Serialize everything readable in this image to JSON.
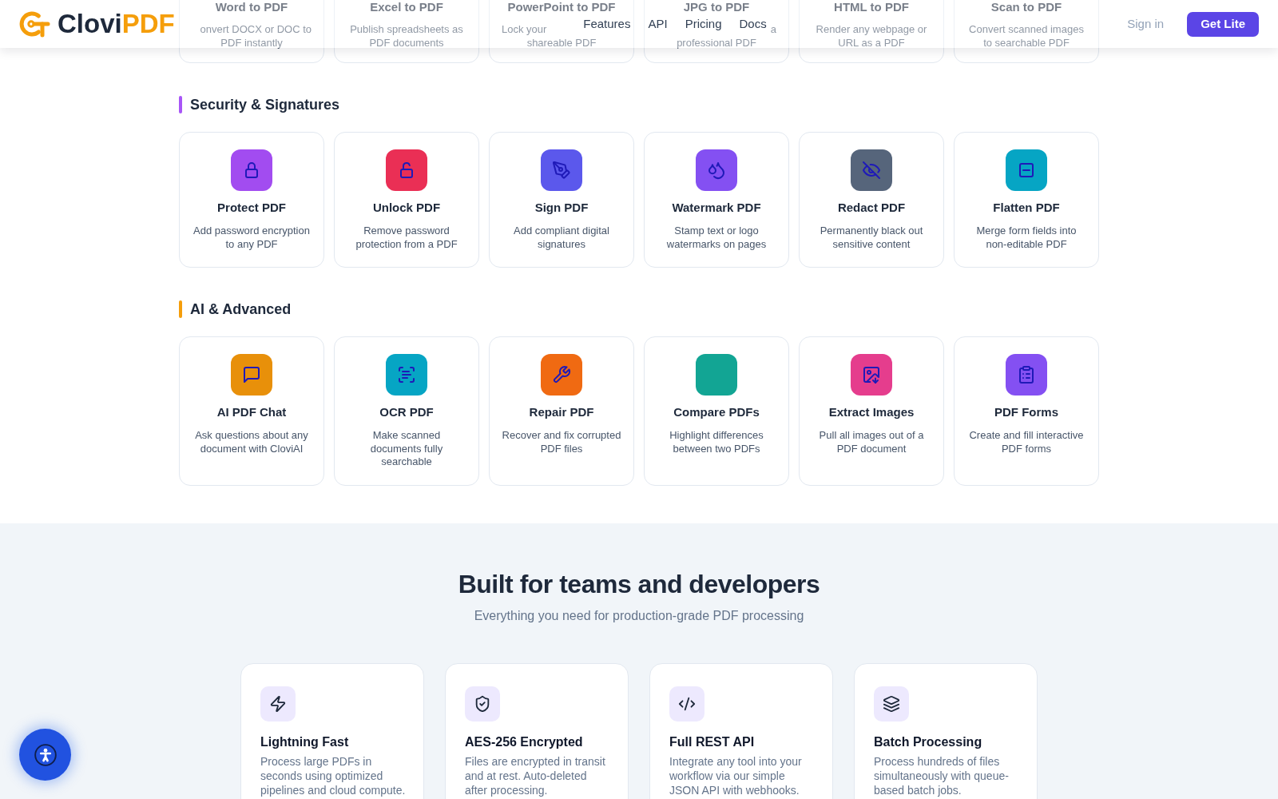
{
  "header": {
    "logo": {
      "name": "Clovi",
      "accent": "PDF"
    },
    "nav": [
      "Features",
      "API",
      "Pricing",
      "Docs"
    ],
    "sign_in": "Sign in",
    "cta": "Get Lite"
  },
  "tools_above": [
    {
      "title": "Word to PDF",
      "lines": [
        {
          "text": "onvert DOCX or DOC to",
          "kind": "tail"
        },
        {
          "text": "PDF instantly",
          "kind": "full"
        }
      ]
    },
    {
      "title": "Excel to PDF",
      "lines": [
        {
          "text": "Publish spreadsheets as",
          "kind": "full"
        },
        {
          "text": "PDF documents",
          "kind": "full"
        }
      ]
    },
    {
      "title": "PowerPoint to PDF",
      "lines": [
        {
          "text": "Lock your",
          "kind": "head"
        },
        {
          "text": "shareable PDF",
          "kind": "full"
        }
      ]
    },
    {
      "title": "JPG to PDF",
      "lines": [
        {
          "text": "a",
          "kind": "tail"
        },
        {
          "text": "professional PDF",
          "kind": "full"
        }
      ]
    },
    {
      "title": "HTML to PDF",
      "lines": [
        {
          "text": "Render any webpage or",
          "kind": "full"
        },
        {
          "text": "URL as a PDF",
          "kind": "full"
        }
      ]
    },
    {
      "title": "Scan to PDF",
      "lines": [
        {
          "text": "Convert scanned images",
          "kind": "full"
        },
        {
          "text": "to searchable PDF",
          "kind": "full"
        }
      ]
    }
  ],
  "sections": [
    {
      "title": "Security & Signatures",
      "color": "#a855f7",
      "tools": [
        {
          "title": "Protect PDF",
          "description": "Add password encryption to any PDF",
          "color": "#a24cf0"
        },
        {
          "title": "Unlock PDF",
          "description": "Remove password protection from a PDF",
          "color": "#ea2f55"
        },
        {
          "title": "Sign PDF",
          "description": "Add compliant digital signatures",
          "color": "#5b58ec"
        },
        {
          "title": "Watermark PDF",
          "description": "Stamp text or logo watermarks on pages",
          "color": "#8450f2"
        },
        {
          "title": "Redact PDF",
          "description": "Permanently black out sensitive content",
          "color": "#56657b"
        },
        {
          "title": "Flatten PDF",
          "description": "Merge form fields into non-editable PDF",
          "color": "#06a5c4"
        }
      ]
    },
    {
      "title": "AI & Advanced",
      "color": "#f59e0b",
      "tools": [
        {
          "title": "AI PDF Chat",
          "description": "Ask questions about any document with CloviAI",
          "color": "#e8900a"
        },
        {
          "title": "OCR PDF",
          "description": "Make scanned documents fully searchable",
          "color": "#06a5c4"
        },
        {
          "title": "Repair PDF",
          "description": "Recover and fix corrupted PDF files",
          "color": "#f06a12"
        },
        {
          "title": "Compare PDFs",
          "description": "Highlight differences between two PDFs",
          "color": "#12a594"
        },
        {
          "title": "Extract Images",
          "description": "Pull all images out of a PDF document",
          "color": "#e53d8d"
        },
        {
          "title": "PDF Forms",
          "description": "Create and fill interactive PDF forms",
          "color": "#8450f2"
        }
      ]
    }
  ],
  "features": {
    "title": "Built for teams and developers",
    "subtitle": "Everything you need for production-grade PDF processing",
    "cards": [
      {
        "title": "Lightning Fast",
        "description": "Process large PDFs in seconds using optimized pipelines and cloud compute."
      },
      {
        "title": "AES-256 Encrypted",
        "description": "Files are encrypted in transit and at rest. Auto-deleted after processing."
      },
      {
        "title": "Full REST API",
        "description": "Integrate any tool into your workflow via our simple JSON API with webhooks."
      },
      {
        "title": "Batch Processing",
        "description": "Process hundreds of files simultaneously with queue-based batch jobs."
      }
    ]
  }
}
